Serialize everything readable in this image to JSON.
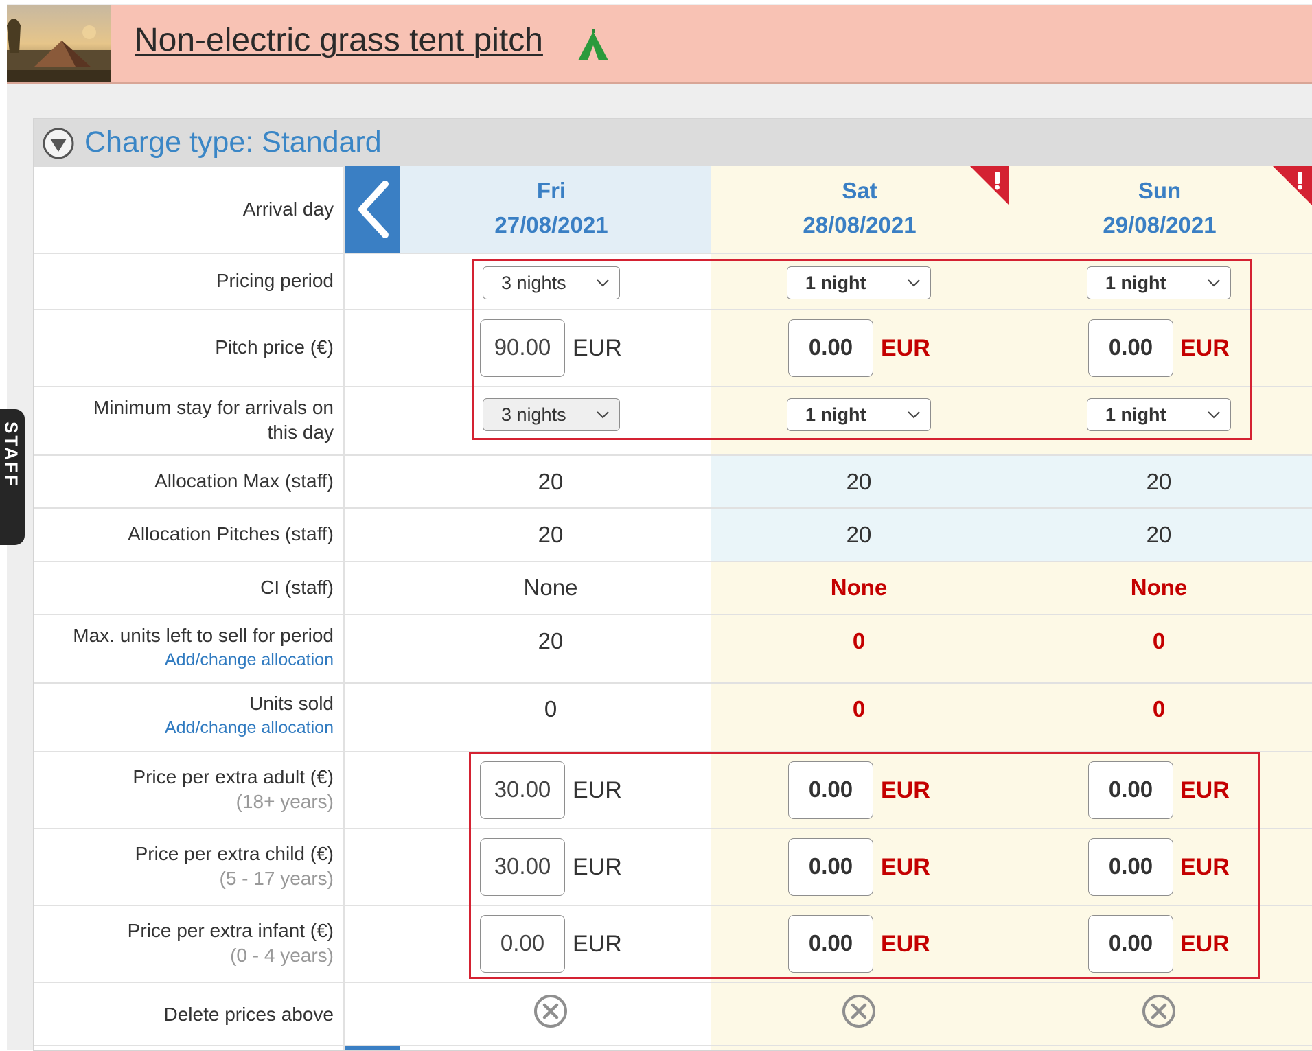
{
  "header": {
    "title": "Non-electric grass tent pitch",
    "thumbnail_icon": "campsite-photo",
    "title_icon": "tent-icon",
    "background": "#f8c2b4"
  },
  "staff_tab": {
    "label": "STAFF"
  },
  "panel": {
    "charge_title": "Charge type: Standard",
    "collapse_icon": "chevron-down-circle-icon"
  },
  "colors": {
    "accent": "#3a7fc4",
    "error": "#c40000",
    "highlight_box": "#d42232"
  },
  "labels": {
    "arrival_day": "Arrival day",
    "pricing_period": "Pricing period",
    "pitch_price": "Pitch price (€)",
    "min_stay": "Minimum stay for arrivals on this day",
    "alloc_max": "Allocation Max (staff)",
    "alloc_pitches": "Allocation Pitches (staff)",
    "ci": "CI (staff)",
    "max_units": "Max. units left to sell for period",
    "units_sold": "Units sold",
    "add_change_link": "Add/change allocation",
    "extra_adult": "Price per extra adult (€)",
    "extra_adult_sub": "(18+ years)",
    "extra_child": "Price per extra child (€)",
    "extra_child_sub": "(5 - 17 years)",
    "extra_infant": "Price per extra infant (€)",
    "extra_infant_sub": "(0 - 4 years)",
    "delete_prices": "Delete prices above"
  },
  "days": [
    {
      "weekday": "Fri",
      "date": "27/08/2021",
      "warning": false,
      "pricing_period": "3 nights",
      "pitch_price": "90.00",
      "currency": "EUR",
      "min_stay": "3 nights",
      "alloc_max": "20",
      "alloc_pitches": "20",
      "ci": "None",
      "max_units": "20",
      "units_sold": "0",
      "extra_adult": "30.00",
      "extra_child": "30.00",
      "extra_infant": "0.00"
    },
    {
      "weekday": "Sat",
      "date": "28/08/2021",
      "warning": true,
      "pricing_period": "1 night",
      "pitch_price": "0.00",
      "currency": "EUR",
      "min_stay": "1 night",
      "alloc_max": "20",
      "alloc_pitches": "20",
      "ci": "None",
      "max_units": "0",
      "units_sold": "0",
      "extra_adult": "0.00",
      "extra_child": "0.00",
      "extra_infant": "0.00"
    },
    {
      "weekday": "Sun",
      "date": "29/08/2021",
      "warning": true,
      "pricing_period": "1 night",
      "pitch_price": "0.00",
      "currency": "EUR",
      "min_stay": "1 night",
      "alloc_max": "20",
      "alloc_pitches": "20",
      "ci": "None",
      "max_units": "0",
      "units_sold": "0",
      "extra_adult": "0.00",
      "extra_child": "0.00",
      "extra_infant": "0.00"
    }
  ]
}
